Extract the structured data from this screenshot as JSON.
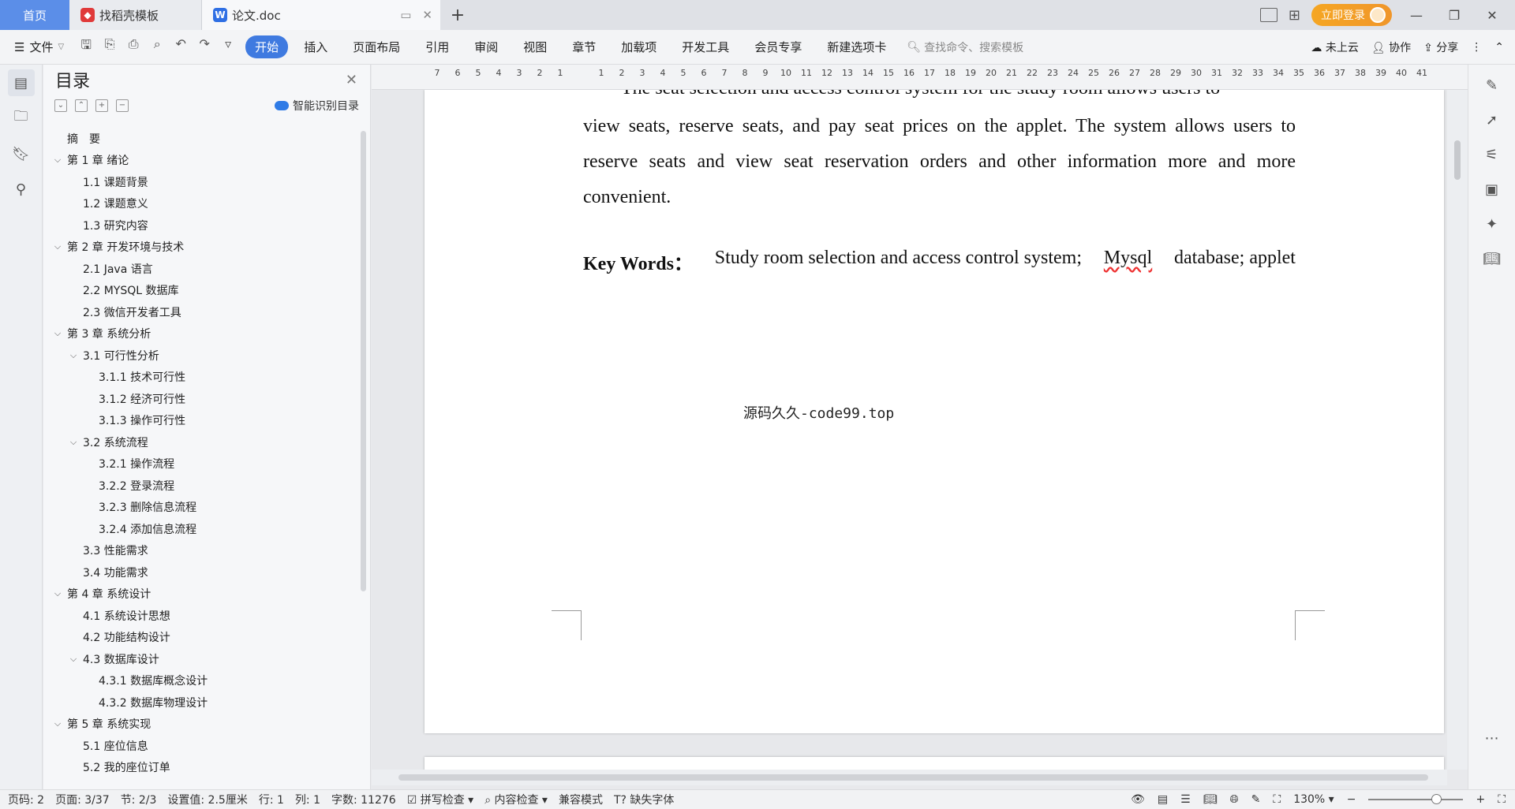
{
  "tabs": {
    "home": "首页",
    "template": "找稻壳模板",
    "document": "论文.doc"
  },
  "titlebar": {
    "login": "立即登录"
  },
  "ribbon": {
    "file": "文件",
    "tabs": [
      "开始",
      "插入",
      "页面布局",
      "引用",
      "审阅",
      "视图",
      "章节",
      "加载项",
      "开发工具",
      "会员专享",
      "新建选项卡"
    ],
    "active_tab": "开始",
    "search_placeholder": "查找命令、搜索模板",
    "cloud": "未上云",
    "collab": "协作",
    "share": "分享"
  },
  "toc": {
    "title": "目录",
    "smart_label": "智能识别目录",
    "items": [
      {
        "text": "摘　要",
        "level": 1,
        "chev": ""
      },
      {
        "text": "第 1 章  绪论",
        "level": 1,
        "chev": "v"
      },
      {
        "text": "1.1  课题背景",
        "level": 2,
        "chev": ""
      },
      {
        "text": "1.2  课题意义",
        "level": 2,
        "chev": ""
      },
      {
        "text": "1.3  研究内容",
        "level": 2,
        "chev": ""
      },
      {
        "text": "第 2 章  开发环境与技术",
        "level": 1,
        "chev": "v"
      },
      {
        "text": "2.1 Java 语言",
        "level": 2,
        "chev": ""
      },
      {
        "text": "2.2 MYSQL 数据库",
        "level": 2,
        "chev": ""
      },
      {
        "text": "2.3 微信开发者工具",
        "level": 2,
        "chev": ""
      },
      {
        "text": "第 3 章  系统分析",
        "level": 1,
        "chev": "v"
      },
      {
        "text": "3.1  可行性分析",
        "level": 2,
        "chev": "v"
      },
      {
        "text": "3.1.1  技术可行性",
        "level": 3,
        "chev": ""
      },
      {
        "text": "3.1.2  经济可行性",
        "level": 3,
        "chev": ""
      },
      {
        "text": "3.1.3  操作可行性",
        "level": 3,
        "chev": ""
      },
      {
        "text": "3.2  系统流程",
        "level": 2,
        "chev": "v"
      },
      {
        "text": "3.2.1  操作流程",
        "level": 3,
        "chev": ""
      },
      {
        "text": "3.2.2  登录流程",
        "level": 3,
        "chev": ""
      },
      {
        "text": "3.2.3  删除信息流程",
        "level": 3,
        "chev": ""
      },
      {
        "text": "3.2.4  添加信息流程",
        "level": 3,
        "chev": ""
      },
      {
        "text": "3.3  性能需求",
        "level": 2,
        "chev": ""
      },
      {
        "text": "3.4  功能需求",
        "level": 2,
        "chev": ""
      },
      {
        "text": "第 4 章  系统设计",
        "level": 1,
        "chev": "v"
      },
      {
        "text": "4.1  系统设计思想",
        "level": 2,
        "chev": ""
      },
      {
        "text": "4.2  功能结构设计",
        "level": 2,
        "chev": ""
      },
      {
        "text": "4.3  数据库设计",
        "level": 2,
        "chev": "v"
      },
      {
        "text": "4.3.1  数据库概念设计",
        "level": 3,
        "chev": ""
      },
      {
        "text": "4.3.2  数据库物理设计",
        "level": 3,
        "chev": ""
      },
      {
        "text": "第 5 章  系统实现",
        "level": 1,
        "chev": "v"
      },
      {
        "text": "5.1  座位信息",
        "level": 2,
        "chev": ""
      },
      {
        "text": "5.2  我的座位订单",
        "level": 2,
        "chev": ""
      }
    ]
  },
  "ruler": [
    "7",
    "6",
    "5",
    "4",
    "3",
    "2",
    "1",
    "",
    "1",
    "2",
    "3",
    "4",
    "5",
    "6",
    "7",
    "8",
    "9",
    "10",
    "11",
    "12",
    "13",
    "14",
    "15",
    "16",
    "17",
    "18",
    "19",
    "20",
    "21",
    "22",
    "23",
    "24",
    "25",
    "26",
    "27",
    "28",
    "29",
    "30",
    "31",
    "32",
    "33",
    "34",
    "35",
    "36",
    "37",
    "38",
    "39",
    "40",
    "41"
  ],
  "document": {
    "line0": "The seat selection and access control system for the study room allows users to",
    "line1": "view seats, reserve seats, and pay seat prices on the applet. The system allows users to",
    "line2": "reserve seats and view seat reservation orders and other information more and more",
    "line3": "convenient.",
    "kw_label": "Key Words：",
    "kw_a": "Study room selection and access control system;",
    "kw_b": "Mysql",
    "kw_c": "database; applet",
    "watermark": "源码久久-code99.top"
  },
  "status": {
    "page_num": "页码: 2",
    "page": "页面: 3/37",
    "section": "节: 2/3",
    "setting": "设置值: 2.5厘米",
    "row": "行: 1",
    "col": "列: 1",
    "words": "字数: 11276",
    "spell": "拼写检查",
    "content": "内容检查",
    "compat": "兼容模式",
    "font_missing": "缺失字体",
    "zoom": "130%",
    "zoom_level": 0.72
  }
}
